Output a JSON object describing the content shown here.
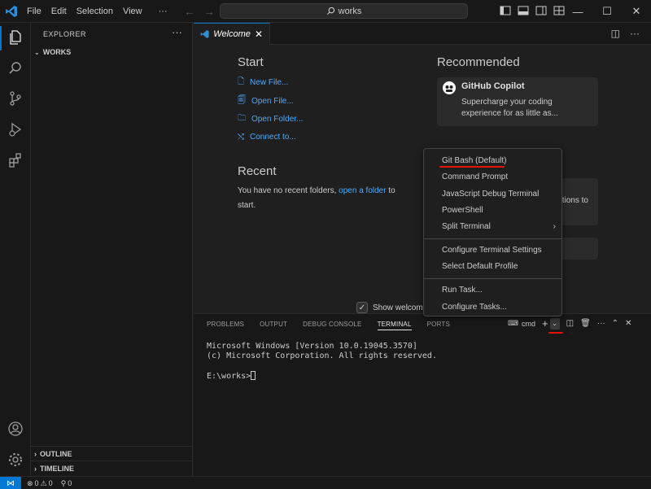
{
  "menu": [
    "File",
    "Edit",
    "Selection",
    "View",
    "···"
  ],
  "search": {
    "text": "works"
  },
  "sidebar": {
    "title": "EXPLORER",
    "folder": "WORKS",
    "outline": "OUTLINE",
    "timeline": "TIMELINE"
  },
  "tab": {
    "label": "Welcome"
  },
  "welcome": {
    "start_title": "Start",
    "start_items": [
      "New File...",
      "Open File...",
      "Open Folder...",
      "Connect to..."
    ],
    "recent_title": "Recent",
    "recent_text_1": "You have no recent folders,",
    "recent_link": "open a folder",
    "recent_text_2": "to start.",
    "recommended_title": "Recommended",
    "copilot_title": "GitHub Copilot",
    "copilot_desc": "Supercharge your coding experience for as little as...",
    "card2_text": "tions to",
    "show_welcome": "Show welcom"
  },
  "panel": {
    "tabs": [
      "PROBLEMS",
      "OUTPUT",
      "DEBUG CONSOLE",
      "TERMINAL",
      "PORTS"
    ],
    "terminal_name": "cmd",
    "terminal_lines": [
      "Microsoft Windows [Version 10.0.19045.3570]",
      "(c) Microsoft Corporation. All rights reserved.",
      "",
      "E:\\works>"
    ]
  },
  "context_menu": {
    "items": [
      "Git Bash (Default)",
      "Command Prompt",
      "JavaScript Debug Terminal",
      "PowerShell",
      "Split Terminal",
      "Configure Terminal Settings",
      "Select Default Profile",
      "Run Task...",
      "Configure Tasks..."
    ]
  },
  "status": {
    "errors": "0",
    "warnings": "0",
    "ports": "0"
  },
  "colors": {
    "accent": "#0078d4",
    "link": "#4daafc",
    "annotation": "#e51400"
  }
}
